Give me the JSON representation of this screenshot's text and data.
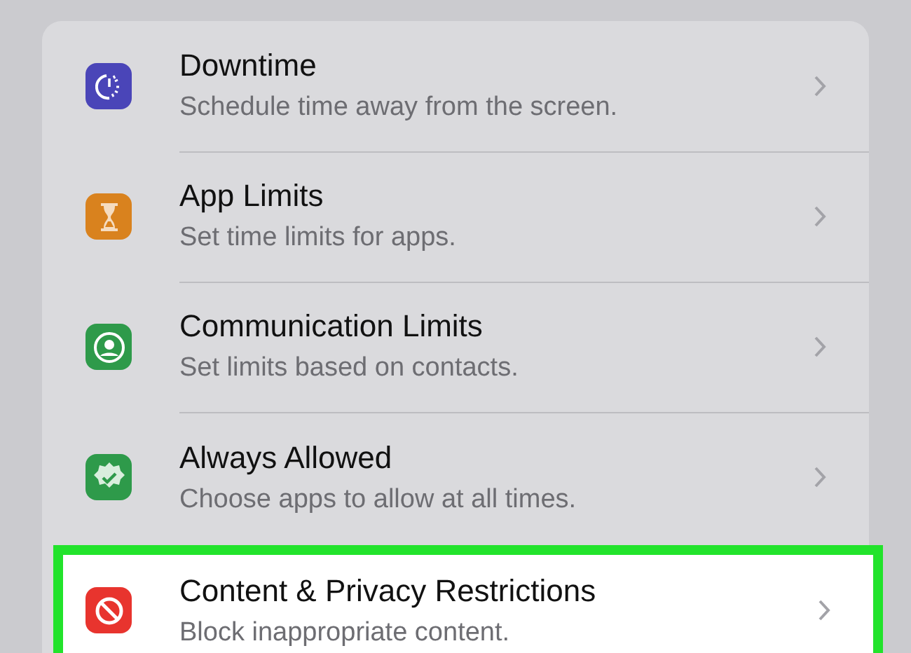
{
  "rows": [
    {
      "kind": "downtime",
      "color": "#4a45b8",
      "title": "Downtime",
      "subtitle": "Schedule time away from the screen.",
      "highlighted": false
    },
    {
      "kind": "hourglass",
      "color": "#d9821e",
      "title": "App Limits",
      "subtitle": "Set time limits for apps.",
      "highlighted": false
    },
    {
      "kind": "contact",
      "color": "#2e9a4a",
      "title": "Communication Limits",
      "subtitle": "Set limits based on contacts.",
      "highlighted": false
    },
    {
      "kind": "badge",
      "color": "#2e9a4a",
      "title": "Always Allowed",
      "subtitle": "Choose apps to allow at all times.",
      "highlighted": false
    },
    {
      "kind": "blocked",
      "color": "#e8342e",
      "title": "Content & Privacy Restrictions",
      "subtitle": "Block inappropriate content.",
      "highlighted": true
    }
  ]
}
